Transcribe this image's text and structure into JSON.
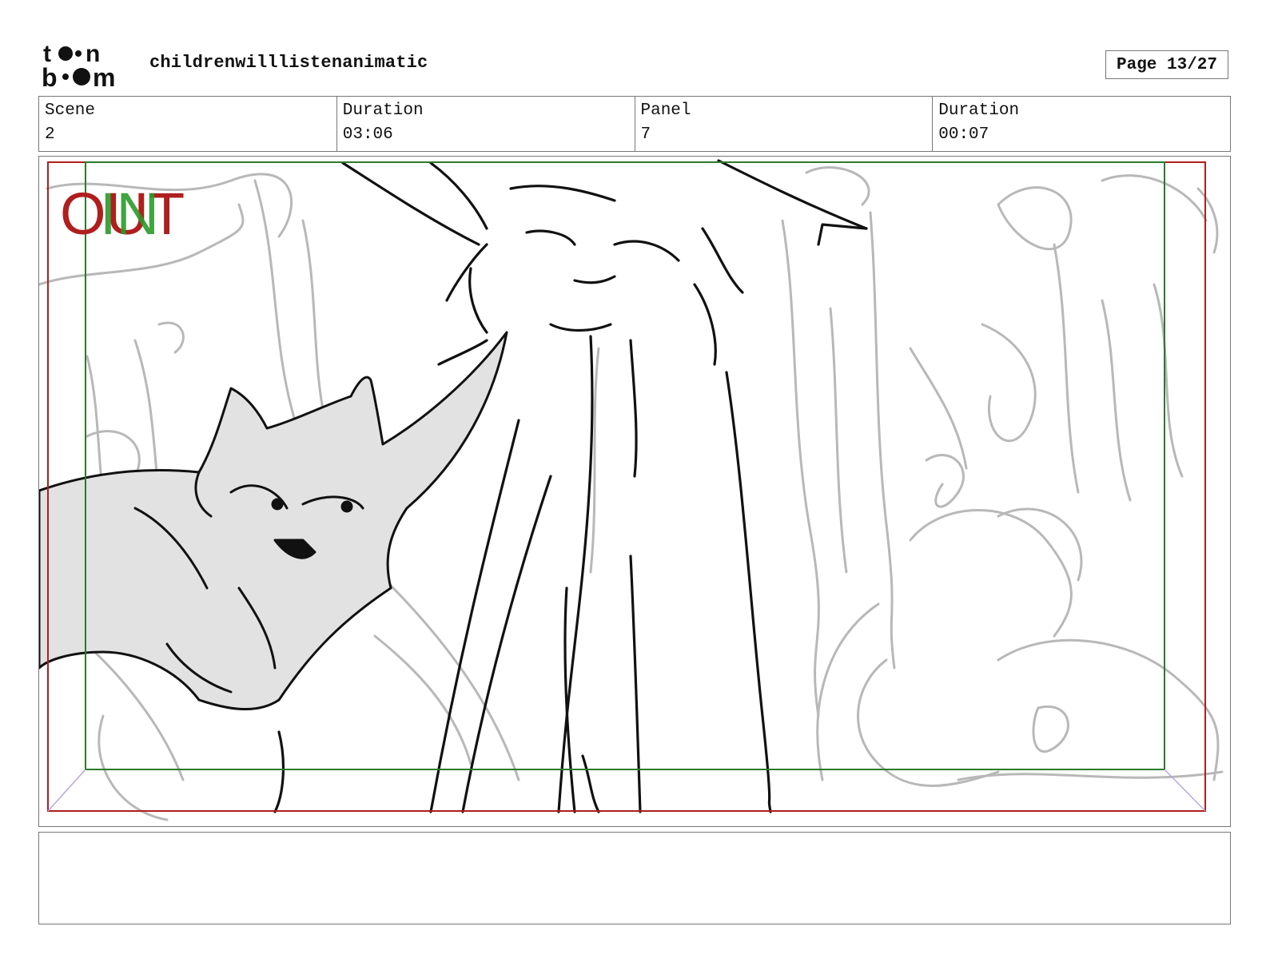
{
  "header": {
    "logo_text": "toon boom",
    "project_title": "childrenwilllistenanimatic",
    "page_label": "Page 13/27"
  },
  "info": {
    "scene_label": "Scene",
    "scene_value": "2",
    "scene_duration_label": "Duration",
    "scene_duration_value": "03:06",
    "panel_label": "Panel",
    "panel_value": "7",
    "panel_duration_label": "Duration",
    "panel_duration_value": "00:07"
  },
  "panel": {
    "out_label": "OUT",
    "in_label": "IN",
    "out_color": "#b01e1e",
    "in_color": "#2a9a2a",
    "sketch_line_color": "#111111",
    "background_line_color": "#b8b8b8",
    "shadow_fill": "#e2e2e2"
  },
  "caption": {
    "text": ""
  }
}
